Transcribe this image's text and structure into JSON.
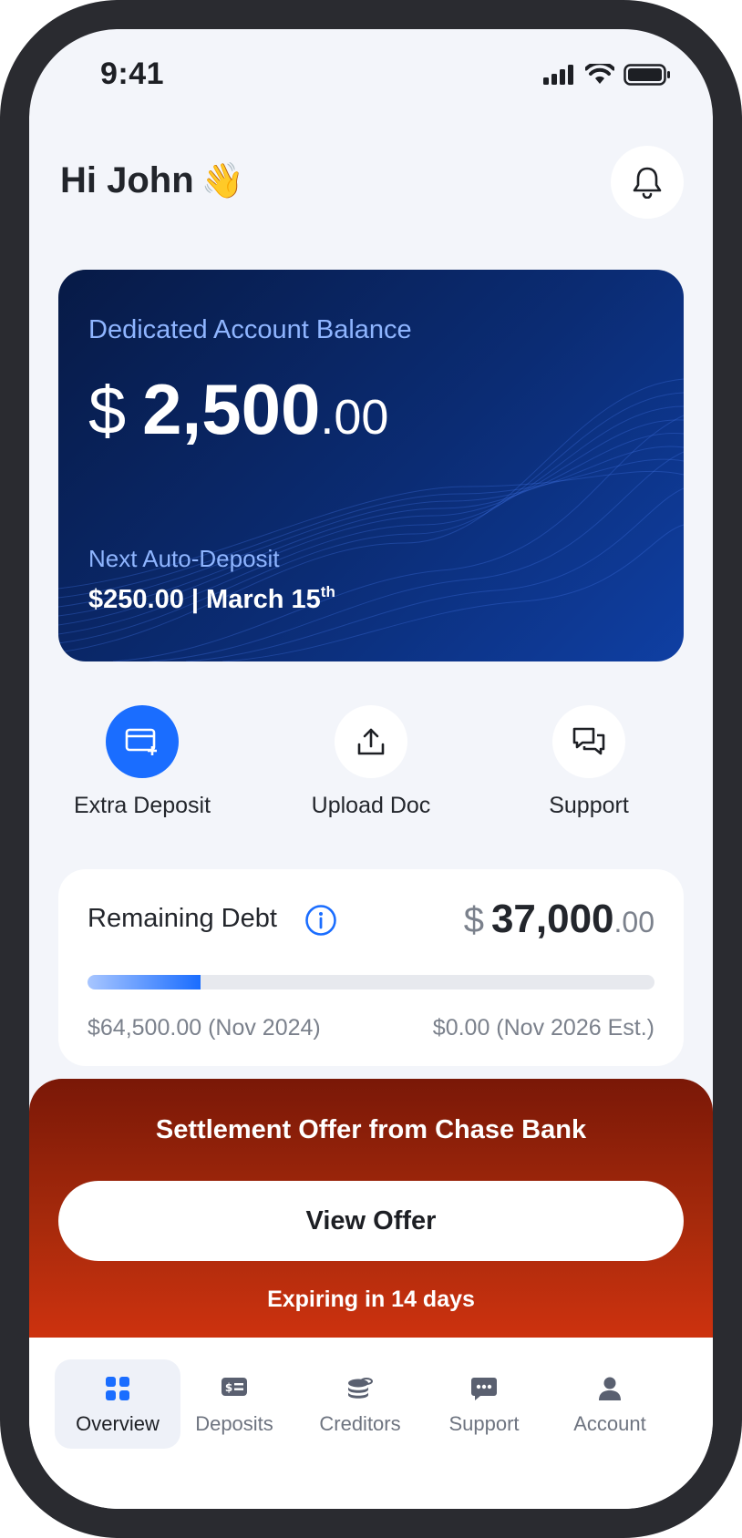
{
  "status_bar": {
    "time": "9:41"
  },
  "header": {
    "greeting": "Hi John",
    "emoji": "👋"
  },
  "balance_card": {
    "label": "Dedicated Account Balance",
    "currency": "$",
    "amount": "2,500",
    "cents": ".00",
    "next_label": "Next Auto-Deposit",
    "next_value": "$250.00 | March 15",
    "next_suffix": "th"
  },
  "actions": [
    {
      "label": "Extra Deposit",
      "icon": "card-plus-icon"
    },
    {
      "label": "Upload Doc",
      "icon": "upload-icon"
    },
    {
      "label": "Support",
      "icon": "chat-bubbles-icon"
    }
  ],
  "debt": {
    "title": "Remaining Debt",
    "currency": "$",
    "amount": "37,000",
    "cents": ".00",
    "progress": 0.2,
    "start": "$64,500.00 (Nov 2024)",
    "end": "$0.00 (Nov 2026 Est.)"
  },
  "offer": {
    "title": "Settlement Offer from Chase Bank",
    "button": "View Offer",
    "expire": "Expiring in 14 days"
  },
  "tabs": [
    {
      "label": "Overview",
      "icon": "grid-icon",
      "active": true
    },
    {
      "label": "Deposits",
      "icon": "bill-icon"
    },
    {
      "label": "Creditors",
      "icon": "coins-icon"
    },
    {
      "label": "Support",
      "icon": "chat-icon"
    },
    {
      "label": "Account",
      "icon": "user-icon"
    }
  ],
  "colors": {
    "primary": "#1a6dff",
    "card_dark": "#071a46",
    "offer_red": "#d8340f"
  }
}
